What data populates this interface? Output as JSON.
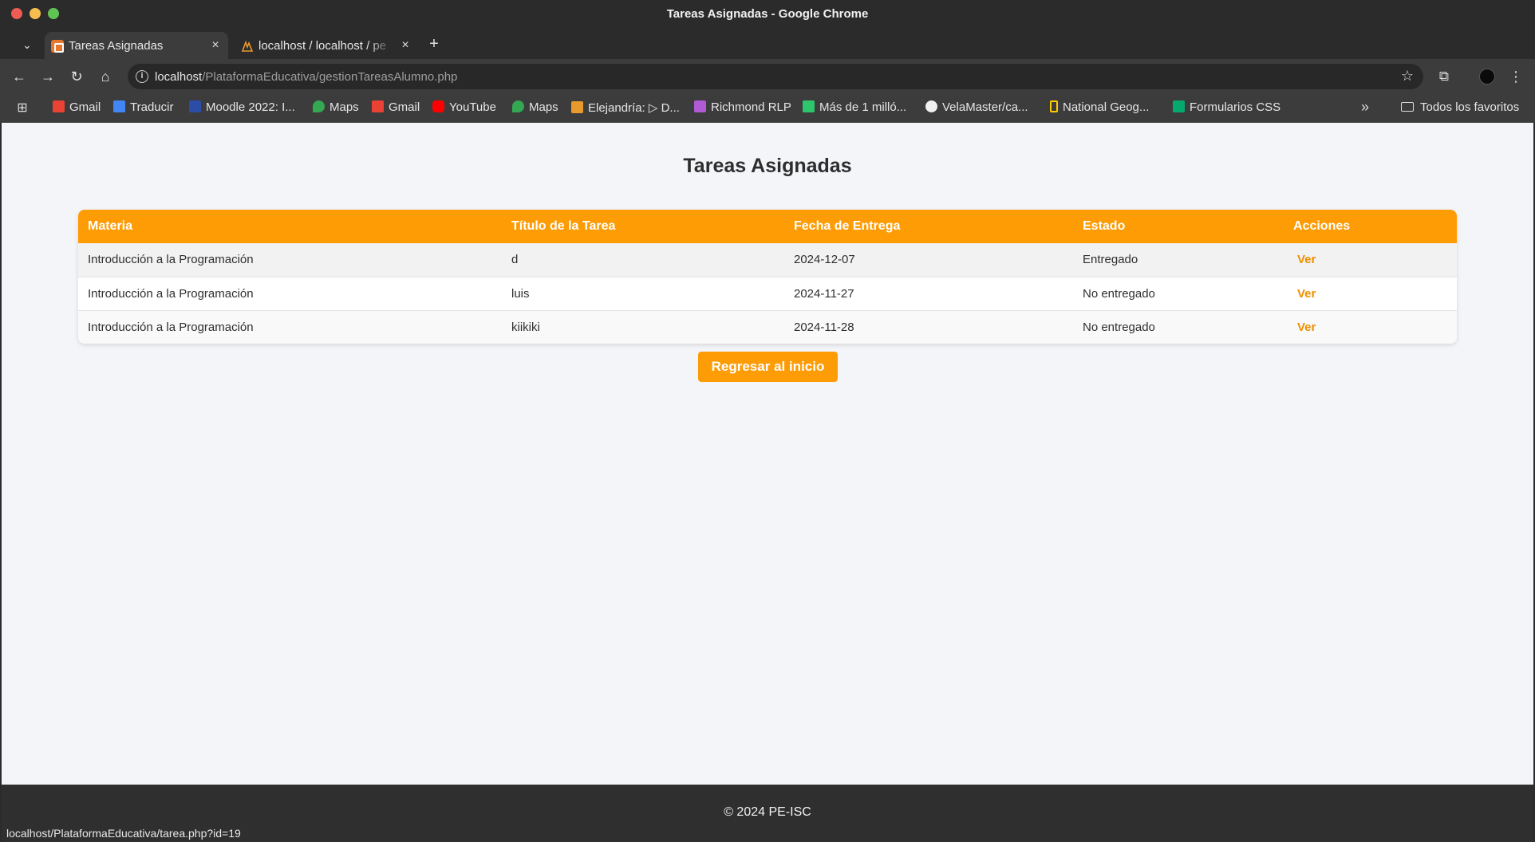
{
  "window": {
    "title": "Tareas Asignadas - Google Chrome"
  },
  "tabs": [
    {
      "label": "Tareas Asignadas",
      "favicon": "xampp-icon"
    },
    {
      "label": "localhost / localhost / pe",
      "favicon": "phpmyadmin-icon"
    }
  ],
  "address": {
    "host": "localhost",
    "path": "/PlataformaEducativa/gestionTareasAlumno.php"
  },
  "bookmarks": [
    {
      "label": "Gmail",
      "icon": "gmail-icon",
      "color": "#ea4335"
    },
    {
      "label": "Traducir",
      "icon": "translate-icon",
      "color": "#4285f4"
    },
    {
      "label": "Moodle 2022: I...",
      "icon": "moodle-icon",
      "color": "#2b4da8"
    },
    {
      "label": "Maps",
      "icon": "maps-icon",
      "color": "#34a853"
    },
    {
      "label": "Gmail",
      "icon": "gmail-icon",
      "color": "#ea4335"
    },
    {
      "label": "YouTube",
      "icon": "youtube-icon",
      "color": "#ff0000"
    },
    {
      "label": "Maps",
      "icon": "maps-icon",
      "color": "#34a853"
    },
    {
      "label": "Elejandría: ▷ D...",
      "icon": "book-icon",
      "color": "#e89b2c"
    },
    {
      "label": "Richmond RLP",
      "icon": "richmond-icon",
      "color": "#b05ad4"
    },
    {
      "label": "Más de 1 milló...",
      "icon": "pixabay-icon",
      "color": "#2ec66d"
    },
    {
      "label": "VelaMaster/ca...",
      "icon": "github-icon",
      "color": "#f0f0f0"
    },
    {
      "label": "National Geog...",
      "icon": "natgeo-icon",
      "color": "#ffcc00"
    },
    {
      "label": "Formularios CSS",
      "icon": "w3-icon",
      "color": "#04aa6d"
    }
  ],
  "bookmarks_folder": "Todos los favoritos",
  "page": {
    "title": "Tareas Asignadas",
    "columns": [
      "Materia",
      "Título de la Tarea",
      "Fecha de Entrega",
      "Estado",
      "Acciones"
    ],
    "rows": [
      {
        "materia": "Introducción a la Programación",
        "titulo": "d",
        "fecha": "2024-12-07",
        "estado": "Entregado",
        "accion": "Ver"
      },
      {
        "materia": "Introducción a la Programación",
        "titulo": "luis",
        "fecha": "2024-11-27",
        "estado": "No entregado",
        "accion": "Ver"
      },
      {
        "materia": "Introducción a la Programación",
        "titulo": "kiikiki",
        "fecha": "2024-11-28",
        "estado": "No entregado",
        "accion": "Ver"
      }
    ],
    "back_button": "Regresar al inicio",
    "footer": "© 2024 PE-ISC"
  },
  "status_bar": "localhost/PlataformaEducativa/tarea.php?id=19",
  "colors": {
    "accent": "#fd9c05",
    "link": "#ee8f00",
    "page_bg": "#f4f5f9",
    "footer_bg": "#2f2f2f"
  }
}
